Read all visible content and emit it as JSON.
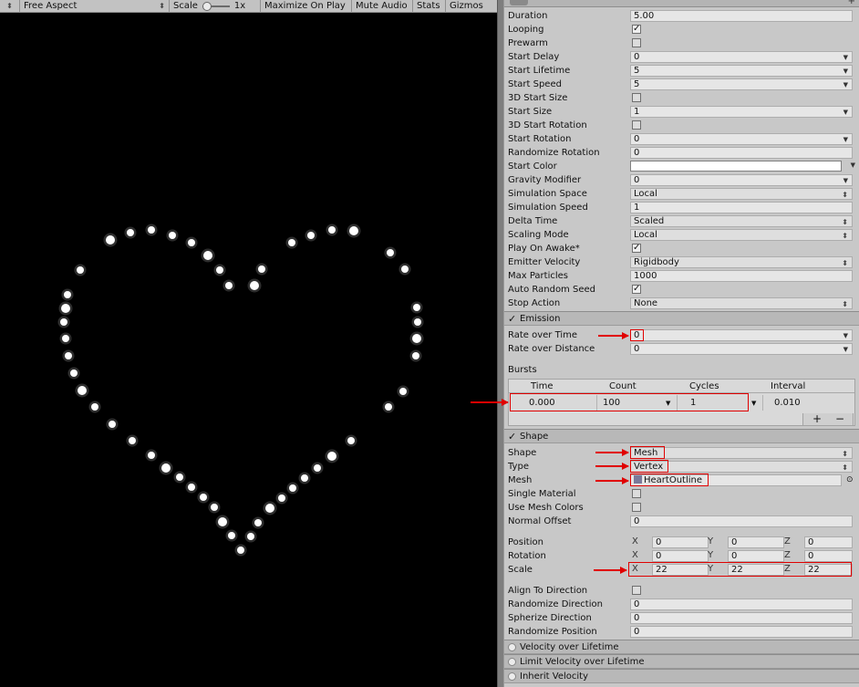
{
  "toolbar": {
    "aspect": "Free Aspect",
    "scale_label": "Scale",
    "scale_value": "1x",
    "maximize": "Maximize On Play",
    "mute": "Mute Audio",
    "stats": "Stats",
    "gizmos": "Gizmos"
  },
  "main": {
    "duration": {
      "label": "Duration",
      "value": "5.00"
    },
    "looping": {
      "label": "Looping"
    },
    "prewarm": {
      "label": "Prewarm"
    },
    "start_delay": {
      "label": "Start Delay",
      "value": "0"
    },
    "start_lifetime": {
      "label": "Start Lifetime",
      "value": "5"
    },
    "start_speed": {
      "label": "Start Speed",
      "value": "5"
    },
    "start_size_3d": {
      "label": "3D Start Size"
    },
    "start_size": {
      "label": "Start Size",
      "value": "1"
    },
    "start_rotation_3d": {
      "label": "3D Start Rotation"
    },
    "start_rotation": {
      "label": "Start Rotation",
      "value": "0"
    },
    "randomize_rotation": {
      "label": "Randomize Rotation",
      "value": "0"
    },
    "start_color": {
      "label": "Start Color",
      "color": "#ffffff"
    },
    "gravity_modifier": {
      "label": "Gravity Modifier",
      "value": "0"
    },
    "simulation_space": {
      "label": "Simulation Space",
      "value": "Local"
    },
    "simulation_speed": {
      "label": "Simulation Speed",
      "value": "1"
    },
    "delta_time": {
      "label": "Delta Time",
      "value": "Scaled"
    },
    "scaling_mode": {
      "label": "Scaling Mode",
      "value": "Local"
    },
    "play_on_awake": {
      "label": "Play On Awake*"
    },
    "emitter_velocity": {
      "label": "Emitter Velocity",
      "value": "Rigidbody"
    },
    "max_particles": {
      "label": "Max Particles",
      "value": "1000"
    },
    "auto_random_seed": {
      "label": "Auto Random Seed"
    },
    "stop_action": {
      "label": "Stop Action",
      "value": "None"
    }
  },
  "emission": {
    "title": "Emission",
    "rate_over_time": {
      "label": "Rate over Time",
      "value": "0"
    },
    "rate_over_distance": {
      "label": "Rate over Distance",
      "value": "0"
    },
    "bursts_label": "Bursts",
    "bursts_headers": {
      "time": "Time",
      "count": "Count",
      "cycles": "Cycles",
      "interval": "Interval"
    },
    "burst": {
      "time": "0.000",
      "count": "100",
      "cycles": "1",
      "interval": "0.010"
    }
  },
  "shape": {
    "title": "Shape",
    "shape": {
      "label": "Shape",
      "value": "Mesh"
    },
    "type": {
      "label": "Type",
      "value": "Vertex"
    },
    "mesh": {
      "label": "Mesh",
      "value": "HeartOutline"
    },
    "single_material": {
      "label": "Single Material"
    },
    "use_mesh_colors": {
      "label": "Use Mesh Colors"
    },
    "normal_offset": {
      "label": "Normal Offset",
      "value": "0"
    },
    "position": {
      "label": "Position",
      "x": "0",
      "y": "0",
      "z": "0"
    },
    "rotation": {
      "label": "Rotation",
      "x": "0",
      "y": "0",
      "z": "0"
    },
    "scale": {
      "label": "Scale",
      "x": "22",
      "y": "22",
      "z": "22"
    },
    "axis": {
      "x": "X",
      "y": "Y",
      "z": "Z"
    },
    "align_to_direction": {
      "label": "Align To Direction"
    },
    "randomize_direction": {
      "label": "Randomize Direction",
      "value": "0"
    },
    "spherize_direction": {
      "label": "Spherize Direction",
      "value": "0"
    },
    "randomize_position": {
      "label": "Randomize Position",
      "value": "0"
    }
  },
  "modules": {
    "velocity_over_lifetime": "Velocity over Lifetime",
    "limit_velocity": "Limit Velocity over Lifetime",
    "inherit_velocity": "Inherit Velocity"
  },
  "colors": {
    "highlight": "#e00000",
    "particle": "#ffffff"
  }
}
